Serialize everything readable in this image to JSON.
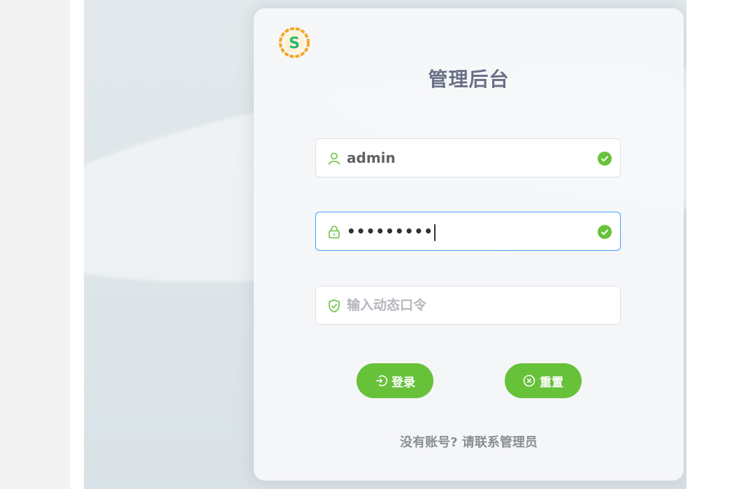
{
  "login": {
    "title": "管理后台",
    "username": {
      "value": "admin",
      "icon": "user-icon",
      "status_icon": "check-circle-icon"
    },
    "password": {
      "masked_value": "•••••••••",
      "icon": "lock-icon",
      "status_icon": "check-circle-icon"
    },
    "otp": {
      "placeholder": "输入动态口令",
      "icon": "shield-check-icon"
    },
    "buttons": {
      "login_label": "登录",
      "reset_label": "重置"
    },
    "footer_text": "没有账号? 请联系管理员"
  },
  "colors": {
    "accent": "#67c23a",
    "title": "#6a7086",
    "focus_border": "#409eff"
  }
}
